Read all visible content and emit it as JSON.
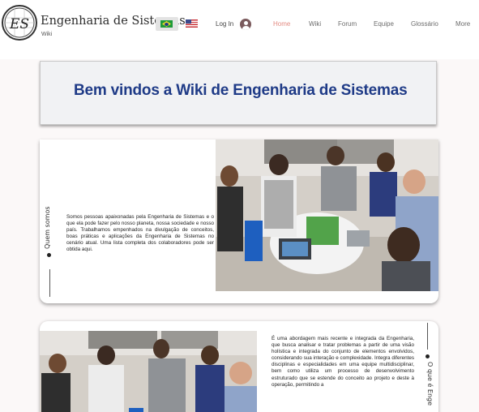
{
  "header": {
    "logo_alt": "ES",
    "site_title": "Engenharia de Sistemas",
    "site_subtitle": "Wiki",
    "languages": [
      "pt-BR",
      "en-US"
    ],
    "login_label": "Log In",
    "nav": [
      "Home",
      "Wiki",
      "Forum",
      "Equipe",
      "Glossário",
      "More"
    ],
    "active_nav": "Home",
    "accent_color": "#e38b82"
  },
  "banner": {
    "title": "Bem vindos a Wiki de Engenharia de Sistemas",
    "title_color": "#1f3b87"
  },
  "section_about": {
    "label": "Quem somos",
    "text": "Somos pessoas apaixonadas pela Engenharia de Sistemas e o que ela pode fazer pelo nosso planeta, nossa sociedade e nosso país. Trabalhamos empenhados na divulgação de conceitos, boas práticas e aplicações da Engenharia de Sistemas no cenário atual. Uma lista completa dos colaboradores pode ser obtida aqui."
  },
  "section_what": {
    "label": "O que é Enge",
    "text": "É uma abordagem mais recente e integrada da Engenharia, que busca analisar e tratar problemas a partir de uma visão holística e integrada do conjunto de elementos envolvidos, considerando sua interação e complexidade. Integra diferentes disciplinas e especialidades em uma equipe multidisciplinar, bem como utiliza um processo de desenvolvimento estruturado que se estende do conceito ao projeto e deste à operação, permitindo a"
  }
}
